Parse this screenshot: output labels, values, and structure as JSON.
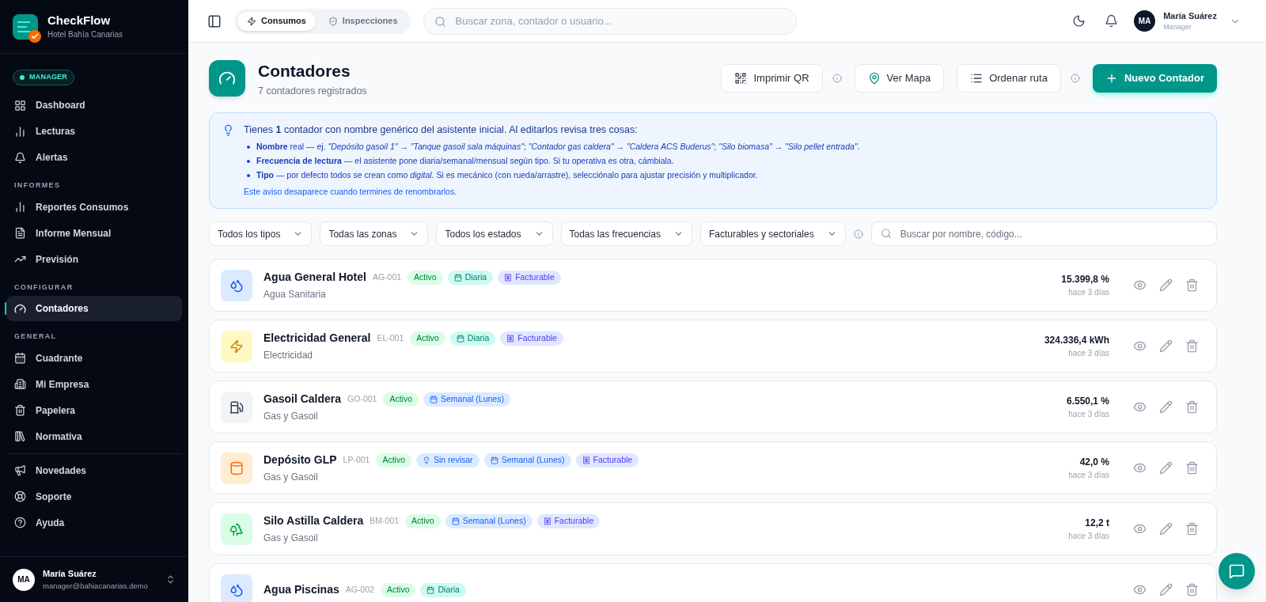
{
  "brand": {
    "name": "CheckFlow",
    "subtitle": "Hotel Bahía Canarias"
  },
  "role_badge": "MANAGER",
  "sidebar": {
    "sections": [
      {
        "items": [
          {
            "label": "Dashboard",
            "selected": false
          },
          {
            "label": "Lecturas",
            "selected": false
          },
          {
            "label": "Alertas",
            "selected": false
          }
        ]
      },
      {
        "title": "INFORMES",
        "items": [
          {
            "label": "Reportes Consumos",
            "selected": false
          },
          {
            "label": "Informe Mensual",
            "selected": false
          },
          {
            "label": "Previsión",
            "selected": false
          }
        ]
      },
      {
        "title": "CONFIGURAR",
        "items": [
          {
            "label": "Contadores",
            "selected": true
          }
        ]
      },
      {
        "title": "GENERAL",
        "items": [
          {
            "label": "Cuadrante",
            "selected": false
          },
          {
            "label": "Mi Empresa",
            "selected": false
          },
          {
            "label": "Papelera",
            "selected": false
          },
          {
            "label": "Normativa",
            "selected": false
          }
        ]
      },
      {
        "items": [
          {
            "label": "Novedades",
            "selected": false
          },
          {
            "label": "Soporte",
            "selected": false
          },
          {
            "label": "Ayuda",
            "selected": false
          }
        ]
      }
    ],
    "user": {
      "initials": "MA",
      "name": "María Suárez",
      "email": "manager@bahiacanarias.demo"
    }
  },
  "topbar": {
    "tabs": [
      {
        "label": "Consumos",
        "selected": true
      },
      {
        "label": "Inspecciones",
        "selected": false
      }
    ],
    "search": {
      "placeholder": "Buscar zona, contador o usuario..."
    },
    "user": {
      "initials": "MA",
      "name": "María Suárez",
      "role": "Manager"
    }
  },
  "page": {
    "title": "Contadores",
    "subtitle": "7 contadores registrados",
    "actions": [
      {
        "label": "Imprimir QR",
        "kind": "outline",
        "info": true
      },
      {
        "label": "Ver Mapa",
        "kind": "outline",
        "info": false
      },
      {
        "label": "Ordenar ruta",
        "kind": "outline",
        "info": true
      },
      {
        "label": "Nuevo Contador",
        "kind": "primary",
        "info": false
      }
    ]
  },
  "notice": {
    "headline": "Tienes **1** contador con nombre genérico del asistente inicial. Al editarlos revisa tres cosas:",
    "points": [
      "**Nombre** real — ej. *\"Depósito gasoil 1\"* → *\"Tanque gasoil sala máquinas\"*; *\"Contador gas caldera\"* → *\"Caldera ACS Buderus\"*; *\"Silo biomasa\"* → *\"Silo pellet entrada\"*.",
      "**Frecuencia de lectura** — el asistente pone diaria/semanal/mensual según tipo. Si tu operativa es otra, cámbiala.",
      "**Tipo** — por defecto todos se crean como *digital*. Si es mecánico (con rueda/arrastre), selecciónalo para ajustar precisión y multiplicador."
    ],
    "footer": "Este aviso desaparece cuando termines de renombrarlos."
  },
  "filters": {
    "selects": [
      "Todos los tipos",
      "Todas las zonas",
      "Todos los estados",
      "Todas las frecuencias",
      "Facturables y sectoriales"
    ],
    "search": {
      "placeholder": "Buscar por nombre, código..."
    }
  },
  "meters": [
    {
      "name": "Agua General Hotel",
      "code": "AG-001",
      "kind": "water",
      "category": "Agua Sanitaria",
      "tags": [
        {
          "label": "Activo",
          "kind": "status"
        },
        {
          "label": "Diaria",
          "kind": "daily"
        },
        {
          "label": "Facturable",
          "kind": "billing"
        }
      ],
      "value": "15.399,8 %",
      "updated": "hace 3 días"
    },
    {
      "name": "Electricidad General",
      "code": "EL-001",
      "kind": "electric",
      "category": "Electricidad",
      "tags": [
        {
          "label": "Activo",
          "kind": "status"
        },
        {
          "label": "Diaria",
          "kind": "daily"
        },
        {
          "label": "Facturable",
          "kind": "billing"
        }
      ],
      "value": "324.336,4 kWh",
      "updated": "hace 3 días"
    },
    {
      "name": "Gasoil Caldera",
      "code": "GO-001",
      "kind": "fuel",
      "category": "Gas y Gasoil",
      "tags": [
        {
          "label": "Activo",
          "kind": "status"
        },
        {
          "label": "Semanal (Lunes)",
          "kind": "weekly"
        }
      ],
      "value": "6.550,1 %",
      "updated": "hace 3 días"
    },
    {
      "name": "Depósito GLP",
      "code": "LP-001",
      "kind": "tank",
      "category": "Gas y Gasoil",
      "tags": [
        {
          "label": "Activo",
          "kind": "status"
        },
        {
          "label": "Sin revisar",
          "kind": "review"
        },
        {
          "label": "Semanal (Lunes)",
          "kind": "weekly"
        },
        {
          "label": "Facturable",
          "kind": "billing"
        }
      ],
      "value": "42,0 %",
      "updated": "hace 3 días"
    },
    {
      "name": "Silo Astilla Caldera",
      "code": "BM-001",
      "kind": "biomass",
      "category": "Gas y Gasoil",
      "tags": [
        {
          "label": "Activo",
          "kind": "status"
        },
        {
          "label": "Semanal (Lunes)",
          "kind": "weekly"
        },
        {
          "label": "Facturable",
          "kind": "billing"
        }
      ],
      "value": "12,2 t",
      "updated": "hace 3 días"
    },
    {
      "name": "Agua Piscinas",
      "code": "AG-002",
      "kind": "water",
      "tags": [
        {
          "label": "Activo",
          "kind": "status"
        },
        {
          "label": "Diaria",
          "kind": "daily"
        }
      ]
    }
  ]
}
